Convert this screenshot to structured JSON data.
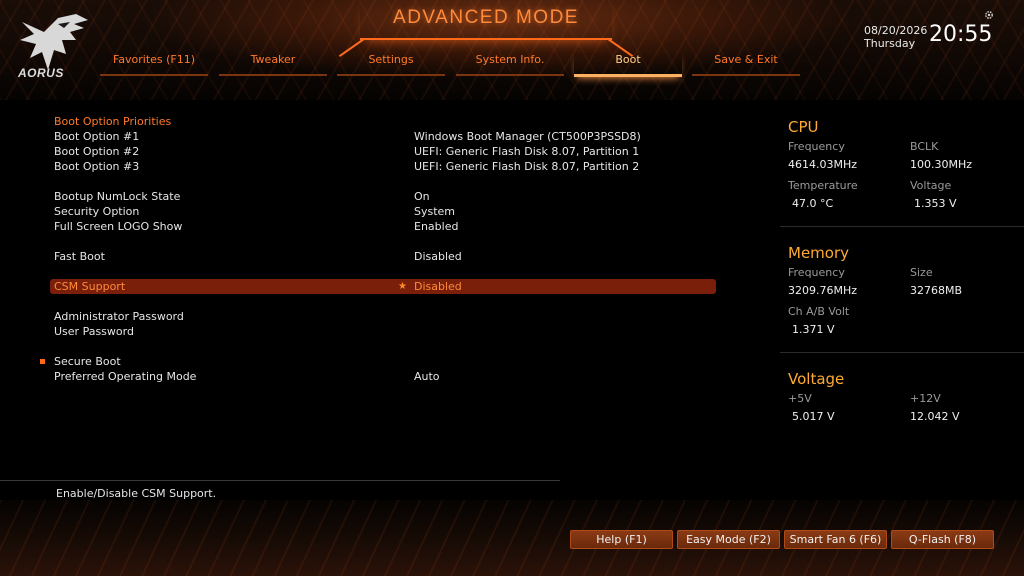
{
  "header": {
    "title": "ADVANCED MODE",
    "logo_text": "AORUS",
    "date": "08/20/2026",
    "day": "Thursday",
    "time": "20:55"
  },
  "tabs": [
    {
      "label": "Favorites (F11)"
    },
    {
      "label": "Tweaker"
    },
    {
      "label": "Settings"
    },
    {
      "label": "System Info."
    },
    {
      "label": "Boot",
      "active": true
    },
    {
      "label": "Save & Exit"
    }
  ],
  "settings": {
    "boot_option_priorities": "Boot Option Priorities",
    "rows": [
      {
        "label": "Boot Option #1",
        "value": "Windows Boot Manager (CT500P3PSSD8)"
      },
      {
        "label": "Boot Option #2",
        "value": "UEFI: Generic Flash Disk 8.07, Partition 1"
      },
      {
        "label": "Boot Option #3",
        "value": "UEFI: Generic Flash Disk 8.07, Partition 2"
      },
      {
        "label": "Bootup NumLock State",
        "value": "On"
      },
      {
        "label": "Security Option",
        "value": "System"
      },
      {
        "label": "Full Screen LOGO Show",
        "value": "Enabled"
      },
      {
        "label": "Fast Boot",
        "value": "Disabled"
      },
      {
        "label": "CSM Support",
        "value": "Disabled"
      },
      {
        "label": "Administrator Password",
        "value": ""
      },
      {
        "label": "User Password",
        "value": ""
      },
      {
        "label": "Secure Boot",
        "value": ""
      },
      {
        "label": "Preferred Operating Mode",
        "value": "Auto"
      }
    ]
  },
  "right_panel": {
    "cpu": {
      "title": "CPU",
      "frequency_label": "Frequency",
      "frequency": "4614.03MHz",
      "bclk_label": "BCLK",
      "bclk": "100.30MHz",
      "temperature_label": "Temperature",
      "temperature": "47.0 °C",
      "voltage_label": "Voltage",
      "voltage": "1.353 V"
    },
    "memory": {
      "title": "Memory",
      "frequency_label": "Frequency",
      "frequency": "3209.76MHz",
      "size_label": "Size",
      "size": "32768MB",
      "volt_label": "Ch A/B Volt",
      "volt": "1.371 V"
    },
    "voltage": {
      "title": "Voltage",
      "v5_label": "+5V",
      "v5": "5.017 V",
      "v12_label": "+12V",
      "v12": "12.042 V"
    }
  },
  "help_text": "Enable/Disable CSM Support.",
  "footer_buttons": [
    {
      "label": "Help (F1)"
    },
    {
      "label": "Easy Mode (F2)"
    },
    {
      "label": "Smart Fan 6 (F6)"
    },
    {
      "label": "Q-Flash (F8)"
    }
  ],
  "colors": {
    "accent": "#ff7a2a",
    "selected_row": "#7a1f0a",
    "panel_heading": "#ffaa33"
  }
}
